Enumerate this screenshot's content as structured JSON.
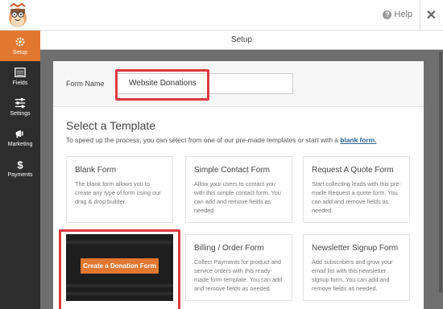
{
  "header": {
    "help_label": "Help",
    "section_title": "Setup"
  },
  "sidebar": {
    "items": [
      {
        "label": "Setup",
        "icon": "gear-icon",
        "active": true
      },
      {
        "label": "Fields",
        "icon": "list-icon",
        "active": false
      },
      {
        "label": "Settings",
        "icon": "sliders-icon",
        "active": false
      },
      {
        "label": "Marketing",
        "icon": "megaphone-icon",
        "active": false
      },
      {
        "label": "Payments",
        "icon": "dollar-icon",
        "active": false
      }
    ]
  },
  "form_name": {
    "label": "Form Name",
    "value": "Website Donations"
  },
  "templates": {
    "title": "Select a Template",
    "subtitle": "To speed up the process, you can select from one of our pre-made templates or start with a",
    "subtitle_link": "blank form.",
    "cards": [
      {
        "title": "Blank Form",
        "desc": "The blank form allows you to create any type of form using our drag & drop builder."
      },
      {
        "title": "Simple Contact Form",
        "desc": "Allow your users to contact you with this simple contact form. You can add and remove fields as needed."
      },
      {
        "title": "Request A Quote Form",
        "desc": "Start collecting leads with this pre-made Request a quote form. You can add and remove fields as needed."
      },
      {
        "title": "Billing / Order Form",
        "desc": "Collect Payments for product and service orders with this ready-made form template. You can add and remove fields as needed."
      },
      {
        "title": "Newsletter Signup Form",
        "desc": "Add subscribers and grow your email list with this newsletter signup form. You can add and remove fields as needed."
      }
    ],
    "donation_button": "Create a Donation Form"
  },
  "colors": {
    "accent": "#e27730",
    "highlight": "#e0383f",
    "sidebar_bg": "#2d2d2d",
    "link": "#2a6496"
  }
}
